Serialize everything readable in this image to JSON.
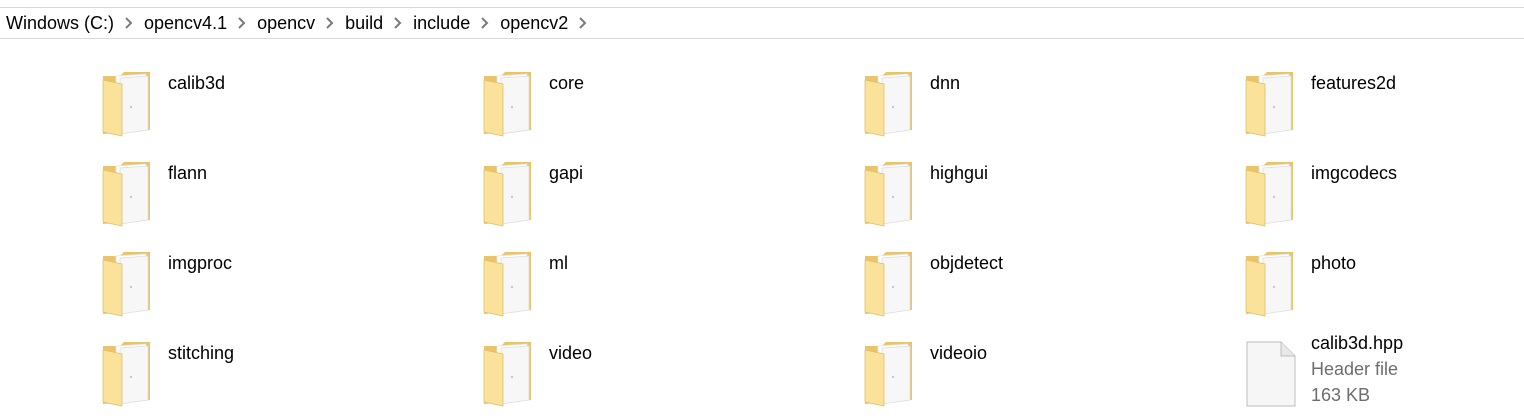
{
  "breadcrumb": {
    "items": [
      "Windows (C:)",
      "opencv4.1",
      "opencv",
      "build",
      "include",
      "opencv2"
    ]
  },
  "files": [
    {
      "name": "calib3d",
      "type": "folder"
    },
    {
      "name": "core",
      "type": "folder"
    },
    {
      "name": "dnn",
      "type": "folder"
    },
    {
      "name": "features2d",
      "type": "folder"
    },
    {
      "name": "flann",
      "type": "folder"
    },
    {
      "name": "gapi",
      "type": "folder"
    },
    {
      "name": "highgui",
      "type": "folder"
    },
    {
      "name": "imgcodecs",
      "type": "folder"
    },
    {
      "name": "imgproc",
      "type": "folder"
    },
    {
      "name": "ml",
      "type": "folder"
    },
    {
      "name": "objdetect",
      "type": "folder"
    },
    {
      "name": "photo",
      "type": "folder"
    },
    {
      "name": "stitching",
      "type": "folder"
    },
    {
      "name": "video",
      "type": "folder"
    },
    {
      "name": "videoio",
      "type": "folder"
    },
    {
      "name": "calib3d.hpp",
      "type": "file",
      "kind": "Header file",
      "size": "163 KB"
    }
  ],
  "colors": {
    "folder_back": "#e9c46a",
    "folder_front": "#fbe29a",
    "paper": "#f7f7f7",
    "separator": "#7a7a7a"
  }
}
